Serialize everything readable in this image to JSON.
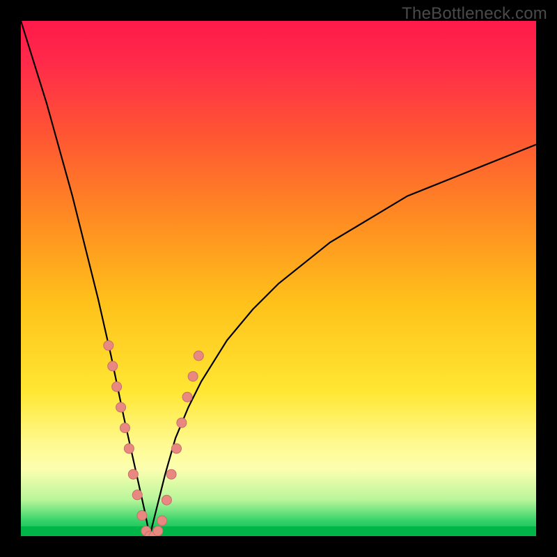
{
  "watermark": "TheBottleneck.com",
  "colors": {
    "frame_bg_top": "#ff1a4a",
    "frame_bg_bottom": "#00b648",
    "curve": "#000000",
    "marker_fill": "#e98880",
    "marker_stroke": "#c37068",
    "page_bg": "#000000",
    "watermark_text": "#4a4a4a"
  },
  "chart_data": {
    "type": "line",
    "title": "",
    "xlabel": "",
    "ylabel": "",
    "xlim": [
      0,
      100
    ],
    "ylim": [
      0,
      100
    ],
    "grid": false,
    "legend": false,
    "series": [
      {
        "name": "bottleneck-curve",
        "comment": "Approximate V-shaped bottleneck curve; minimum near x≈25, y≈0. Values are percentages of plot area width/height.",
        "x": [
          0,
          2.5,
          5,
          7.5,
          10,
          12.5,
          15,
          17.5,
          20,
          22,
          24,
          25,
          26,
          28,
          30,
          32.5,
          35,
          40,
          45,
          50,
          55,
          60,
          65,
          70,
          75,
          80,
          85,
          90,
          95,
          100
        ],
        "y": [
          100,
          92,
          84,
          75,
          66,
          56,
          46,
          35,
          23,
          14,
          5,
          0,
          4,
          12,
          19,
          25,
          30,
          38,
          44,
          49,
          53,
          57,
          60,
          63,
          66,
          68,
          70,
          72,
          74,
          76
        ]
      }
    ],
    "markers": {
      "comment": "Pink dot clusters along the curve near the trough region, read off as approximate (x,y) percentages.",
      "points": [
        {
          "x": 17.0,
          "y": 37
        },
        {
          "x": 17.8,
          "y": 33
        },
        {
          "x": 18.6,
          "y": 29
        },
        {
          "x": 19.4,
          "y": 25
        },
        {
          "x": 20.2,
          "y": 21
        },
        {
          "x": 21.0,
          "y": 17
        },
        {
          "x": 21.8,
          "y": 12
        },
        {
          "x": 22.6,
          "y": 8
        },
        {
          "x": 23.5,
          "y": 4
        },
        {
          "x": 24.3,
          "y": 1
        },
        {
          "x": 25.0,
          "y": 0
        },
        {
          "x": 25.8,
          "y": 0
        },
        {
          "x": 26.6,
          "y": 1
        },
        {
          "x": 27.4,
          "y": 3
        },
        {
          "x": 28.3,
          "y": 7
        },
        {
          "x": 29.2,
          "y": 12
        },
        {
          "x": 30.2,
          "y": 17
        },
        {
          "x": 31.2,
          "y": 22
        },
        {
          "x": 32.3,
          "y": 27
        },
        {
          "x": 33.4,
          "y": 31
        },
        {
          "x": 34.5,
          "y": 35
        }
      ],
      "radius": 7
    }
  }
}
